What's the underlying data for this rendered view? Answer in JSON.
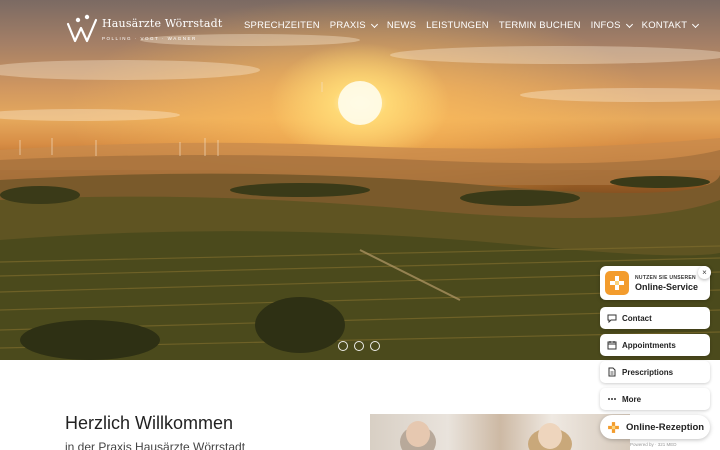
{
  "header": {
    "logo_title": "Hausärzte Wörrstadt",
    "logo_subtitle": "POLLING · VOGT · WAGNER"
  },
  "nav": [
    {
      "label": "SPRECHZEITEN",
      "dropdown": false
    },
    {
      "label": "PRAXIS",
      "dropdown": true
    },
    {
      "label": "NEWS",
      "dropdown": false
    },
    {
      "label": "LEISTUNGEN",
      "dropdown": false
    },
    {
      "label": "TERMIN BUCHEN",
      "dropdown": false
    },
    {
      "label": "INFOS",
      "dropdown": true
    },
    {
      "label": "KONTAKT",
      "dropdown": true
    }
  ],
  "hero": {
    "image": "sunset-vineyard-landscape",
    "slides": 3,
    "active_slide": 1
  },
  "welcome": {
    "title": "Herzlich Willkommen",
    "subtitle": "in der Praxis Hausärzte Wörrstadt"
  },
  "widget": {
    "small_label": "NUTZEN SIE UNSEREN",
    "title": "Online-Service",
    "close": "×",
    "buttons": [
      {
        "label": "Contact",
        "icon": "chat-icon"
      },
      {
        "label": "Appointments",
        "icon": "calendar-icon"
      },
      {
        "label": "Prescriptions",
        "icon": "document-icon"
      },
      {
        "label": "More",
        "icon": "more-icon"
      }
    ],
    "reception_label": "Online-Rezeption",
    "powered_by": "Powered by · 321 MED"
  },
  "colors": {
    "accent": "#f39c2d",
    "text_dark": "#222222",
    "nav_text": "#ffffff"
  }
}
